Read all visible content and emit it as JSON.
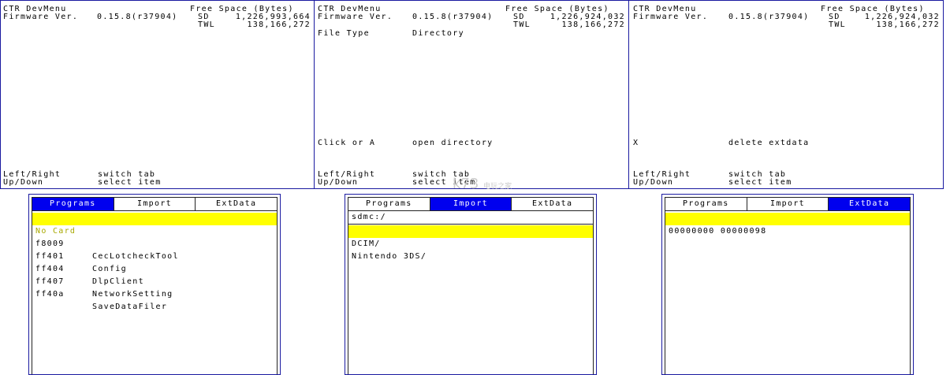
{
  "screens": [
    {
      "title": "CTR DevMenu",
      "firmware_label": "Firmware Ver.",
      "firmware_value": "0.15.8(r37904)",
      "free_space_label": "Free Space (Bytes)",
      "sd_label": "SD",
      "sd_value": "1,226,993,664",
      "twl_label": "TWL",
      "twl_value": "138,166,272",
      "hints": [
        {
          "key": "Left/Right",
          "action": "switch tab"
        },
        {
          "key": "Up/Down",
          "action": "select item"
        }
      ]
    },
    {
      "title": "CTR DevMenu",
      "firmware_label": "Firmware Ver.",
      "firmware_value": "0.15.8(r37904)",
      "free_space_label": "Free Space (Bytes)",
      "sd_label": "SD",
      "sd_value": "1,226,924,032",
      "twl_label": "TWL",
      "twl_value": "138,166,272",
      "info_key": "File Type",
      "info_value": "Directory",
      "action_key": "Click or A",
      "action_value": "open directory",
      "hints": [
        {
          "key": "Left/Right",
          "action": "switch tab"
        },
        {
          "key": "Up/Down",
          "action": "select item"
        }
      ]
    },
    {
      "title": "CTR DevMenu",
      "firmware_label": "Firmware Ver.",
      "firmware_value": "0.15.8(r37904)",
      "free_space_label": "Free Space (Bytes)",
      "sd_label": "SD",
      "sd_value": "1,226,924,032",
      "twl_label": "TWL",
      "twl_value": "138,166,272",
      "action_key": "X",
      "action_value": "delete extdata",
      "hints": [
        {
          "key": "Left/Right",
          "action": "switch tab"
        },
        {
          "key": "Up/Down",
          "action": "select item"
        }
      ]
    }
  ],
  "tabs": [
    "Programs",
    "Import",
    "ExtData"
  ],
  "programs": {
    "no_card": "No Card",
    "items": [
      {
        "id": "f8009",
        "name": "CecLotcheckTool"
      },
      {
        "id": "ff401",
        "name": "Config"
      },
      {
        "id": "ff404",
        "name": "DlpClient"
      },
      {
        "id": "ff407",
        "name": "NetworkSetting"
      },
      {
        "id": "ff40a",
        "name": "SaveDataFiler"
      }
    ]
  },
  "import": {
    "path": "sdmc:/",
    "items": [
      "DCIM/",
      "Nintendo 3DS/"
    ]
  },
  "extdata": {
    "items": [
      "00000000 00000098"
    ]
  },
  "watermark": {
    "text": "k73",
    "sub": "电玩之家"
  },
  "colors": {
    "border": "#1a1aa0",
    "active_tab": "#0000ee",
    "selection": "#ffff00"
  }
}
